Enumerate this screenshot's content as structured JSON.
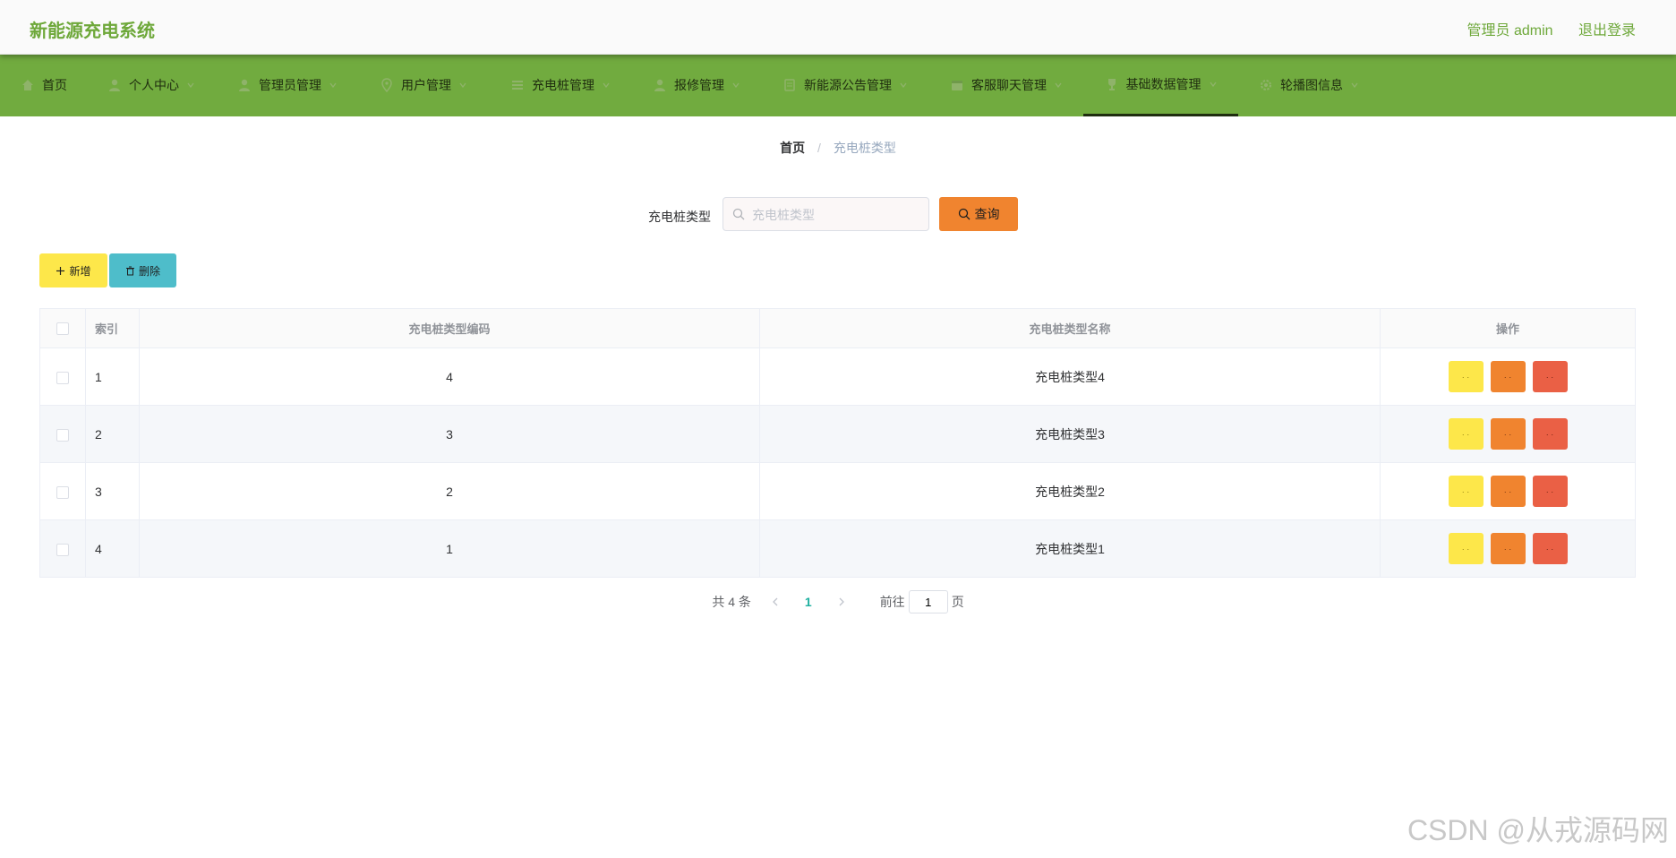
{
  "header": {
    "app_title": "新能源充电系统",
    "user_label": "管理员 admin",
    "logout_label": "退出登录"
  },
  "nav": {
    "items": [
      {
        "label": "首页",
        "icon": "home-icon",
        "has_dropdown": false
      },
      {
        "label": "个人中心",
        "icon": "user-icon",
        "has_dropdown": true
      },
      {
        "label": "管理员管理",
        "icon": "user-icon",
        "has_dropdown": true
      },
      {
        "label": "用户管理",
        "icon": "location-icon",
        "has_dropdown": true
      },
      {
        "label": "充电桩管理",
        "icon": "list-icon",
        "has_dropdown": true
      },
      {
        "label": "报修管理",
        "icon": "user-icon",
        "has_dropdown": true
      },
      {
        "label": "新能源公告管理",
        "icon": "document-icon",
        "has_dropdown": true
      },
      {
        "label": "客服聊天管理",
        "icon": "calendar-icon",
        "has_dropdown": true
      },
      {
        "label": "基础数据管理",
        "icon": "trophy-icon",
        "has_dropdown": true,
        "active": true
      },
      {
        "label": "轮播图信息",
        "icon": "gear-icon",
        "has_dropdown": true
      }
    ]
  },
  "breadcrumb": {
    "home": "首页",
    "separator": "/",
    "current": "充电桩类型"
  },
  "search": {
    "label": "充电桩类型",
    "placeholder": "充电桩类型",
    "value": "",
    "button_label": "查询"
  },
  "actions": {
    "add_label": "新增",
    "delete_label": "删除"
  },
  "table": {
    "headers": {
      "index": "索引",
      "code": "充电桩类型编码",
      "name": "充电桩类型名称",
      "operation": "操作"
    },
    "rows": [
      {
        "index": "1",
        "code": "4",
        "name": "充电桩类型4"
      },
      {
        "index": "2",
        "code": "3",
        "name": "充电桩类型3"
      },
      {
        "index": "3",
        "code": "2",
        "name": "充电桩类型2"
      },
      {
        "index": "4",
        "code": "1",
        "name": "充电桩类型1"
      }
    ],
    "op_buttons": {
      "view": "· ·",
      "edit": "· ·",
      "delete": "· ·"
    }
  },
  "pagination": {
    "total_text": "共 4 条",
    "current_page": "1",
    "goto_label": "前往",
    "goto_value": "1",
    "page_suffix": "页"
  },
  "watermark": "CSDN @从戎源码网",
  "colors": {
    "brand": "#71ab3f",
    "title": "#6ea83a",
    "add": "#fde74a",
    "delete": "#4ebdca",
    "query": "#f0842f",
    "op_delete": "#ea6045"
  }
}
